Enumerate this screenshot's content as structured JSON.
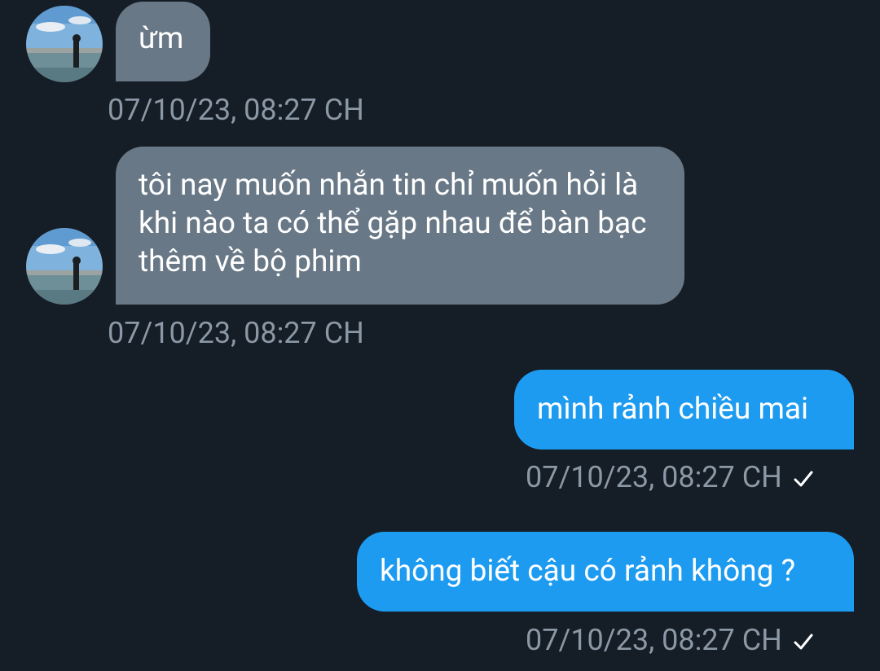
{
  "messages": [
    {
      "direction": "incoming",
      "text": "ừm",
      "timestamp": "07/10/23, 08:27 CH"
    },
    {
      "direction": "incoming",
      "text": "tôi nay muốn nhắn tin chỉ muốn hỏi là khi nào ta có thể gặp nhau để bàn bạc thêm về bộ phim",
      "timestamp": "07/10/23, 08:27 CH"
    },
    {
      "direction": "outgoing",
      "text": "mình rảnh chiều mai",
      "timestamp": "07/10/23, 08:27 CH",
      "status_icon": "check-icon"
    },
    {
      "direction": "outgoing",
      "text": "không biết cậu có rảnh không ?",
      "timestamp": "07/10/23, 08:27 CH",
      "status_icon": "check-icon"
    }
  ],
  "colors": {
    "background": "#151d26",
    "incoming_bubble": "#697886",
    "outgoing_bubble": "#1d9bf0",
    "timestamp_text": "#8b98a5",
    "message_text": "#ffffff"
  }
}
